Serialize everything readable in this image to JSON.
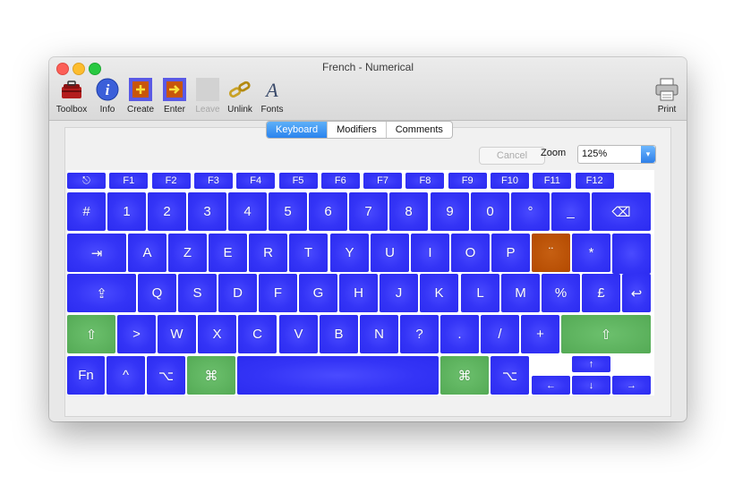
{
  "window": {
    "title": "French - Numerical"
  },
  "toolbar": {
    "toolbox": "Toolbox",
    "info": "Info",
    "create": "Create",
    "enter": "Enter",
    "leave": "Leave",
    "unlink": "Unlink",
    "fonts": "Fonts",
    "print": "Print"
  },
  "tabs": {
    "keyboard": "Keyboard",
    "modifiers": "Modifiers",
    "comments": "Comments",
    "active": "Keyboard"
  },
  "controls": {
    "cancel": "Cancel",
    "zoom_label": "Zoom",
    "zoom_value": "125%"
  },
  "colors": {
    "key_blue": "#3434f6",
    "key_green": "#54aa55",
    "key_orange": "#b34a00",
    "tab_active": "#2a83ee"
  },
  "keyboard": {
    "fn_row": [
      "⎋",
      "F1",
      "F2",
      "F3",
      "F4",
      "F5",
      "F6",
      "F7",
      "F8",
      "F9",
      "F10",
      "F11",
      "F12"
    ],
    "number_row": [
      "#",
      "1",
      "2",
      "3",
      "4",
      "5",
      "6",
      "7",
      "8",
      "9",
      "0",
      "°",
      "_",
      "⌫"
    ],
    "top_row": [
      "⇥",
      "A",
      "Z",
      "E",
      "R",
      "T",
      "Y",
      "U",
      "I",
      "O",
      "P",
      "¨",
      "*"
    ],
    "home_row": [
      "⇪",
      "Q",
      "S",
      "D",
      "F",
      "G",
      "H",
      "J",
      "K",
      "L",
      "M",
      "%",
      "£",
      "↩"
    ],
    "bottom_row": [
      "⇧",
      ">",
      "W",
      "X",
      "C",
      "V",
      "B",
      "N",
      "?",
      ".",
      "/",
      "+",
      "⇧"
    ],
    "modifier_row": [
      "Fn",
      "^",
      "⌥",
      "⌘",
      "",
      "⌘",
      "⌥"
    ],
    "arrows": {
      "up": "↑",
      "left": "←",
      "down": "↓",
      "right": "→"
    }
  }
}
